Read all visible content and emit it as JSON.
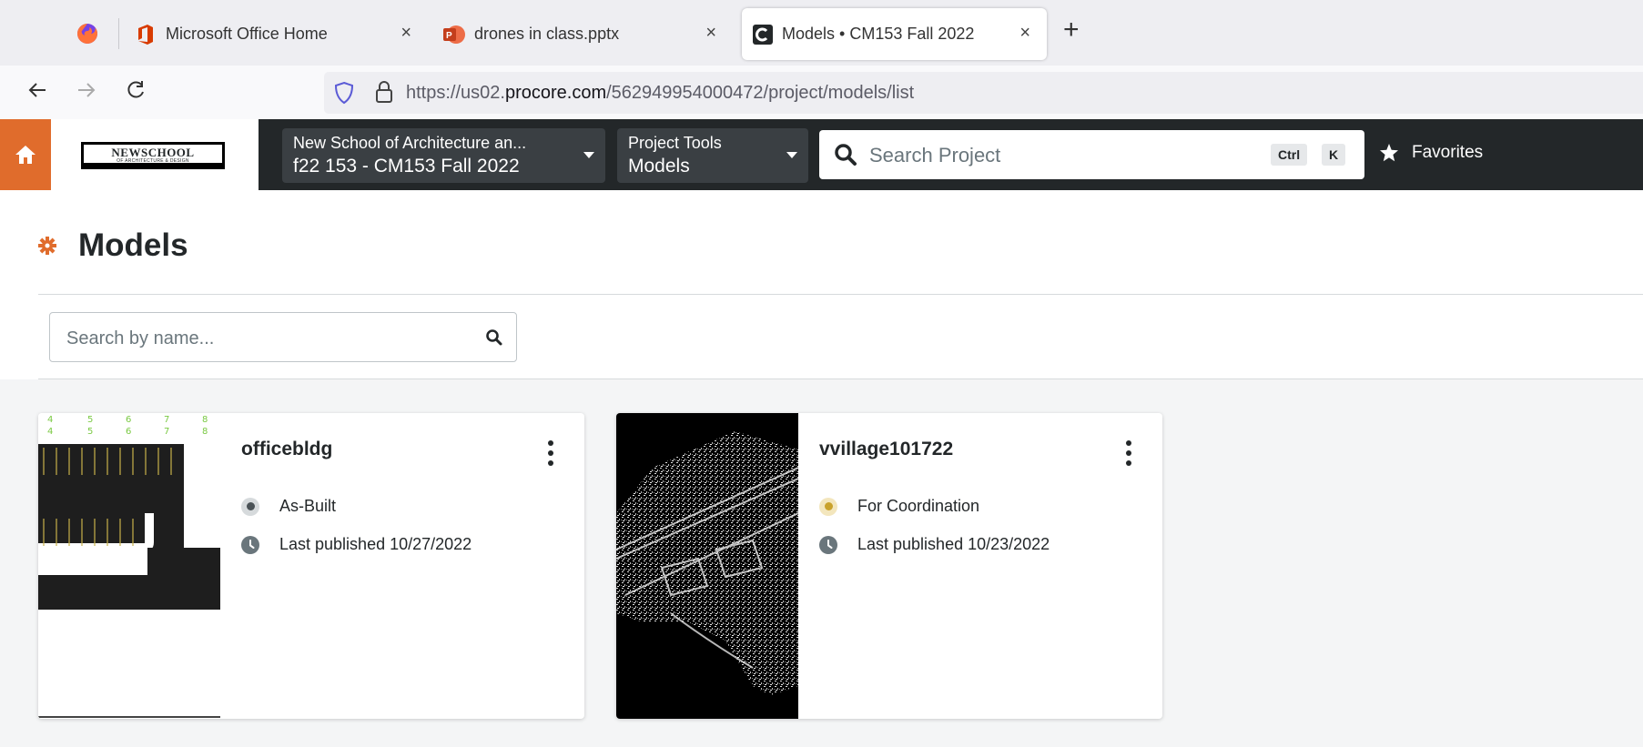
{
  "browser": {
    "tabs": [
      {
        "title": "Microsoft Office Home",
        "icon": "office-icon"
      },
      {
        "title": "drones in class.pptx",
        "icon": "powerpoint-icon"
      },
      {
        "title": "Models • CM153 Fall 2022",
        "icon": "procore-icon",
        "active": true
      }
    ],
    "close_glyph": "×",
    "new_tab_glyph": "+",
    "url_prefix": "https://us02.",
    "url_domain": "procore.com",
    "url_path": "/562949954000472/project/models/list"
  },
  "header": {
    "logo_text": "NEWSCHOOL",
    "logo_subtext": "OF ARCHITECTURE & DESIGN",
    "company_selector": {
      "top": "New School of Architecture an...",
      "bottom": "f22 153 - CM153 Fall 2022"
    },
    "tool_selector": {
      "top": "Project Tools",
      "bottom": "Models"
    },
    "search_placeholder": "Search Project",
    "shortcut_keys": [
      "Ctrl",
      "K"
    ],
    "favorites_label": "Favorites",
    "brand_color": "#e06c2c"
  },
  "page": {
    "title": "Models",
    "search_placeholder": "Search by name..."
  },
  "models": [
    {
      "name": "officebldg",
      "status": "As-Built",
      "status_color": "#5f6b71",
      "published": "Last published 10/27/2022",
      "thumb_numbers": [
        "4",
        "5",
        "6",
        "7",
        "8"
      ]
    },
    {
      "name": "vvillage101722",
      "status": "For Coordination",
      "status_color": "#c9a22c",
      "published": "Last published 10/23/2022"
    }
  ]
}
